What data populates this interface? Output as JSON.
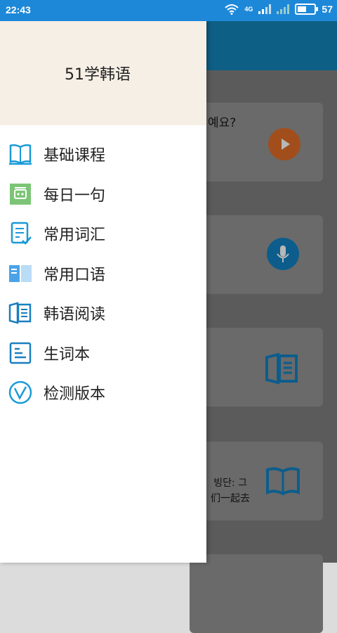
{
  "status_bar": {
    "time": "22:43",
    "network": "4G",
    "battery": "57"
  },
  "drawer": {
    "title": "51学韩语",
    "menu": [
      {
        "label": "基础课程",
        "icon": "book-icon"
      },
      {
        "label": "每日一句",
        "icon": "daily-sentence-icon"
      },
      {
        "label": "常用词汇",
        "icon": "vocabulary-list-icon"
      },
      {
        "label": "常用口语",
        "icon": "phrase-cards-icon"
      },
      {
        "label": "韩语阅读",
        "icon": "reading-book-icon"
      },
      {
        "label": "生词本",
        "icon": "notebook-icon"
      },
      {
        "label": "检测版本",
        "icon": "version-check-icon"
      }
    ]
  },
  "background": {
    "card1_text": "예요?",
    "card4_line1": "빙단: 그",
    "card4_line2": "们一起去"
  },
  "colors": {
    "status_bar": "#1e88d8",
    "accent_blue": "#1a9ad6",
    "header_bg": "#f6efe6"
  }
}
